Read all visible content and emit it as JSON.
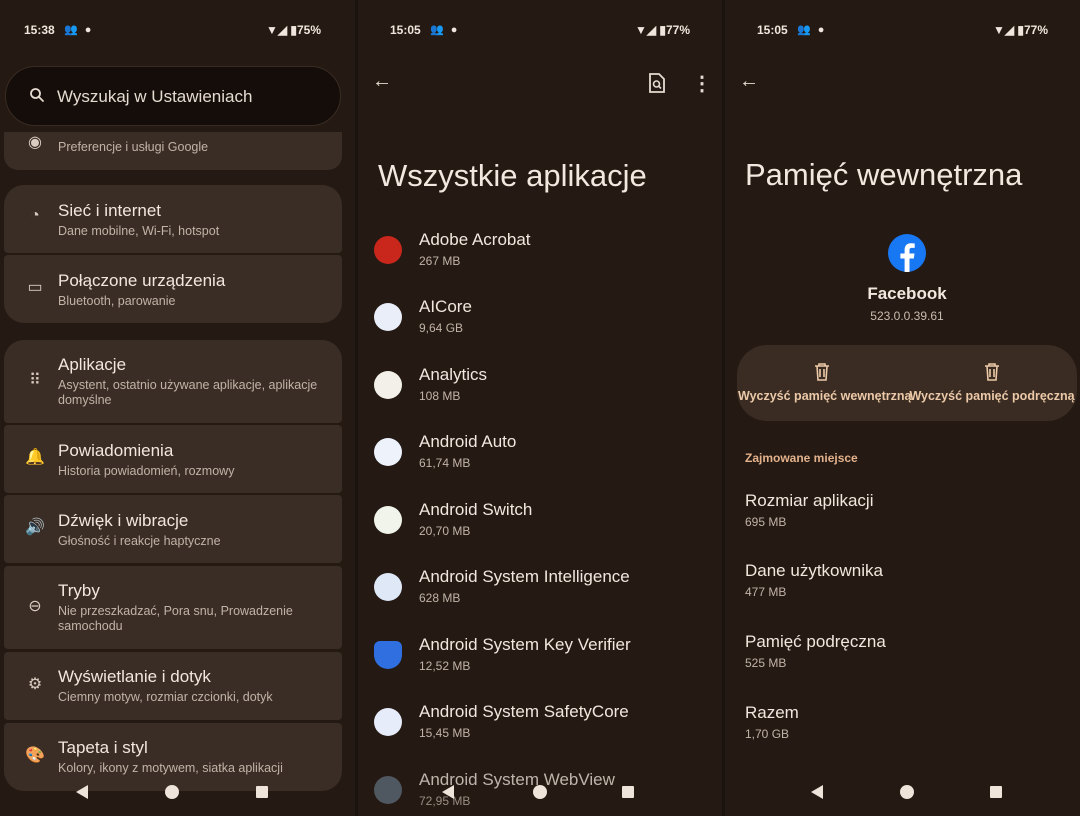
{
  "status_bars": [
    {
      "time": "15:38",
      "icons": "👥 ●",
      "battery": "▼◢ ▮75%"
    },
    {
      "time": "15:05",
      "icons": "👥 ●",
      "battery": "▼◢ ▮77%"
    },
    {
      "time": "15:05",
      "icons": "👥 ●",
      "battery": "▼◢ ▮77%"
    }
  ],
  "settings": {
    "search_placeholder": "Wyszukaj w Ustawieniach",
    "google_subtitle": "Preferencje i usługi Google",
    "items": [
      {
        "icon": "wifi-icon",
        "glyph": "◔",
        "title": "Sieć i internet",
        "subtitle": "Dane mobilne, Wi-Fi, hotspot"
      },
      {
        "icon": "connected-devices-icon",
        "glyph": "▭",
        "title": "Połączone urządzenia",
        "subtitle": "Bluetooth, parowanie"
      },
      {
        "icon": "apps-grid-icon",
        "glyph": "⠿",
        "title": "Aplikacje",
        "subtitle": "Asystent, ostatnio używane aplikacje, aplikacje domyślne"
      },
      {
        "icon": "bell-icon",
        "glyph": "🔔",
        "title": "Powiadomienia",
        "subtitle": "Historia powiadomień, rozmowy"
      },
      {
        "icon": "volume-icon",
        "glyph": "🔊",
        "title": "Dźwięk i wibracje",
        "subtitle": "Głośność i reakcje haptyczne"
      },
      {
        "icon": "do-not-disturb-icon",
        "glyph": "⊖",
        "title": "Tryby",
        "subtitle": "Nie przeszkadzać, Pora snu, Prowadzenie samochodu"
      },
      {
        "icon": "display-icon",
        "glyph": "⚙",
        "title": "Wyświetlanie i dotyk",
        "subtitle": "Ciemny motyw, rozmiar czcionki, dotyk"
      },
      {
        "icon": "palette-icon",
        "glyph": "🎨",
        "title": "Tapeta i styl",
        "subtitle": "Kolory, ikony z motywem, siatka aplikacji"
      }
    ]
  },
  "apps_screen": {
    "title": "Wszystkie aplikacje",
    "apps": [
      {
        "name": "Adobe Acrobat",
        "size": "267 MB",
        "color": "#c9261c"
      },
      {
        "name": "AICore",
        "size": "9,64 GB",
        "color": "#e9eef8"
      },
      {
        "name": "Analytics",
        "size": "108 MB",
        "color": "#f3f0ea"
      },
      {
        "name": "Android Auto",
        "size": "61,74 MB",
        "color": "#eef3fb"
      },
      {
        "name": "Android Switch",
        "size": "20,70 MB",
        "color": "#f1f4ea"
      },
      {
        "name": "Android System Intelligence",
        "size": "628 MB",
        "color": "#dfe8f7"
      },
      {
        "name": "Android System Key Verifier",
        "size": "12,52 MB",
        "color": "#2f6fe0"
      },
      {
        "name": "Android System SafetyCore",
        "size": "15,45 MB",
        "color": "#e6ecfa"
      },
      {
        "name": "Android System WebView",
        "size": "72,95 MB",
        "color": "#5e6c7a"
      }
    ]
  },
  "storage_screen": {
    "title": "Pamięć wewnętrzna",
    "app_name": "Facebook",
    "app_version": "523.0.0.39.61",
    "clear_storage": "Wyczyść pamięć wewnętrzną",
    "clear_cache": "Wyczyść pamięć podręczną",
    "section": "Zajmowane miejsce",
    "rows": [
      {
        "label": "Rozmiar aplikacji",
        "value": "695 MB"
      },
      {
        "label": "Dane użytkownika",
        "value": "477 MB"
      },
      {
        "label": "Pamięć podręczna",
        "value": "525 MB"
      },
      {
        "label": "Razem",
        "value": "1,70 GB"
      }
    ]
  }
}
